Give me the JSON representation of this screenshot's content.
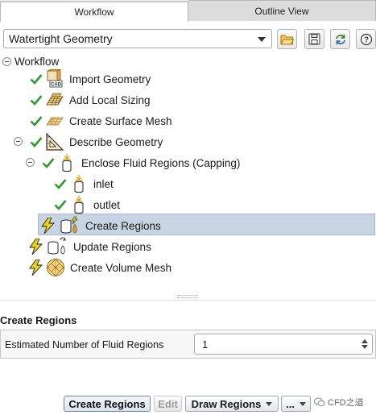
{
  "tabs": [
    {
      "label": "Workflow",
      "active": true
    },
    {
      "label": "Outline View",
      "active": false
    }
  ],
  "workflow_select": {
    "value": "Watertight Geometry"
  },
  "toolbar_icons": [
    "open-folder-icon",
    "save-icon",
    "refresh-icon",
    "help-icon"
  ],
  "tree": {
    "root": "Workflow",
    "items": [
      {
        "label": "Import Geometry",
        "status": "done",
        "icon": "cad-import-icon"
      },
      {
        "label": "Add Local Sizing",
        "status": "done",
        "icon": "local-sizing-icon"
      },
      {
        "label": "Create Surface Mesh",
        "status": "done",
        "icon": "surface-mesh-icon"
      },
      {
        "label": "Describe Geometry",
        "status": "done",
        "icon": "describe-geometry-icon"
      },
      {
        "label": "Enclose Fluid Regions (Capping)",
        "status": "done",
        "icon": "capping-icon"
      },
      {
        "label": "inlet",
        "status": "done",
        "icon": "capping-icon"
      },
      {
        "label": "outlet",
        "status": "done",
        "icon": "capping-icon"
      },
      {
        "label": "Create Regions",
        "status": "pending",
        "icon": "create-regions-icon",
        "selected": true
      },
      {
        "label": "Update Regions",
        "status": "pending",
        "icon": "update-regions-icon"
      },
      {
        "label": "Create Volume Mesh",
        "status": "pending",
        "icon": "volume-mesh-icon"
      }
    ]
  },
  "panel": {
    "title": "Create Regions",
    "field_label": "Estimated Number of Fluid Regions",
    "field_value": "1"
  },
  "buttons": {
    "create": "Create Regions",
    "edit": "Edit",
    "draw": "Draw Regions",
    "more": "..."
  },
  "watermark": "CFD之道",
  "colors": {
    "check": "#2e9a2e",
    "lightning": "#e8d21a",
    "selection": "#c7d5e3"
  }
}
